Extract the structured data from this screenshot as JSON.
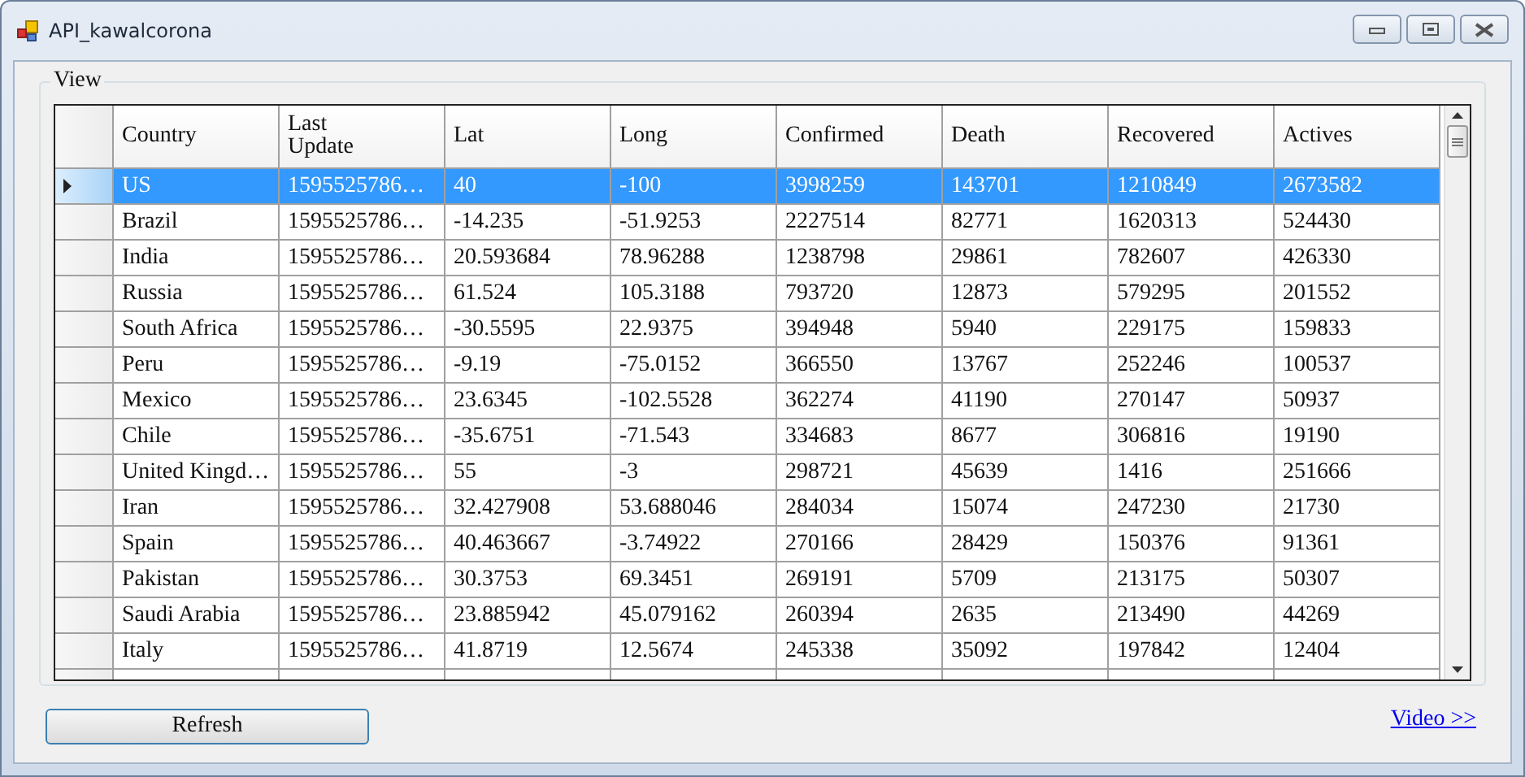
{
  "window": {
    "title": "API_kawalcorona"
  },
  "group": {
    "title": "View"
  },
  "table": {
    "columns": [
      "Country",
      "Last Update",
      "Lat",
      "Long",
      "Confirmed",
      "Death",
      "Recovered",
      "Actives"
    ],
    "rows": [
      {
        "selected": true,
        "cells": [
          "US",
          "1595525786…",
          "40",
          "-100",
          "3998259",
          "143701",
          "1210849",
          "2673582"
        ]
      },
      {
        "selected": false,
        "cells": [
          "Brazil",
          "1595525786…",
          "-14.235",
          "-51.9253",
          "2227514",
          "82771",
          "1620313",
          "524430"
        ]
      },
      {
        "selected": false,
        "cells": [
          "India",
          "1595525786…",
          "20.593684",
          "78.96288",
          "1238798",
          "29861",
          "782607",
          "426330"
        ]
      },
      {
        "selected": false,
        "cells": [
          "Russia",
          "1595525786…",
          "61.524",
          "105.3188",
          "793720",
          "12873",
          "579295",
          "201552"
        ]
      },
      {
        "selected": false,
        "cells": [
          "South Africa",
          "1595525786…",
          "-30.5595",
          "22.9375",
          "394948",
          "5940",
          "229175",
          "159833"
        ]
      },
      {
        "selected": false,
        "cells": [
          "Peru",
          "1595525786…",
          "-9.19",
          "-75.0152",
          "366550",
          "13767",
          "252246",
          "100537"
        ]
      },
      {
        "selected": false,
        "cells": [
          "Mexico",
          "1595525786…",
          "23.6345",
          "-102.5528",
          "362274",
          "41190",
          "270147",
          "50937"
        ]
      },
      {
        "selected": false,
        "cells": [
          "Chile",
          "1595525786…",
          "-35.6751",
          "-71.543",
          "334683",
          "8677",
          "306816",
          "19190"
        ]
      },
      {
        "selected": false,
        "cells": [
          "United Kingd…",
          "1595525786…",
          "55",
          "-3",
          "298721",
          "45639",
          "1416",
          "251666"
        ]
      },
      {
        "selected": false,
        "cells": [
          "Iran",
          "1595525786…",
          "32.427908",
          "53.688046",
          "284034",
          "15074",
          "247230",
          "21730"
        ]
      },
      {
        "selected": false,
        "cells": [
          "Spain",
          "1595525786…",
          "40.463667",
          "-3.74922",
          "270166",
          "28429",
          "150376",
          "91361"
        ]
      },
      {
        "selected": false,
        "cells": [
          "Pakistan",
          "1595525786…",
          "30.3753",
          "69.3451",
          "269191",
          "5709",
          "213175",
          "50307"
        ]
      },
      {
        "selected": false,
        "cells": [
          "Saudi Arabia",
          "1595525786…",
          "23.885942",
          "45.079162",
          "260394",
          "2635",
          "213490",
          "44269"
        ]
      },
      {
        "selected": false,
        "cells": [
          "Italy",
          "1595525786…",
          "41.8719",
          "12.5674",
          "245338",
          "35092",
          "197842",
          "12404"
        ]
      }
    ]
  },
  "buttons": [
    {
      "label": "Refresh"
    }
  ],
  "link": {
    "label": "Video >>"
  }
}
